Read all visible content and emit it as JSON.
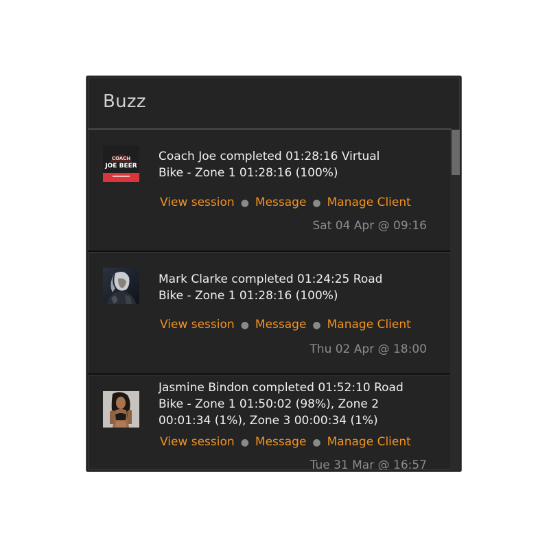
{
  "widget": {
    "title": "Buzz"
  },
  "feed": {
    "items": [
      {
        "summary": "Coach Joe completed 01:28:16 Virtual\nBike  -  Zone 1 01:28:16  (100%)",
        "actions": {
          "view_session": "View session",
          "message": "Message",
          "manage_client": "Manage Client"
        },
        "timestamp": "Sat 04 Apr @ 09:16",
        "avatar_text_top": "COACH",
        "avatar_text_main": "JOE BEER"
      },
      {
        "summary": "Mark Clarke completed 01:24:25 Road\nBike  -  Zone 1 01:28:16  (100%)",
        "actions": {
          "view_session": "View session",
          "message": "Message",
          "manage_client": "Manage Client"
        },
        "timestamp": "Thu 02 Apr @ 18:00"
      },
      {
        "summary": "Jasmine Bindon completed 01:52:10 Road\nBike  -  Zone 1 01:50:02  (98%), Zone 2\n00:01:34 (1%), Zone 3 00:00:34 (1%)",
        "actions": {
          "view_session": "View session",
          "message": "Message",
          "manage_client": "Manage Client"
        },
        "timestamp": "Tue 31 Mar @ 16:57"
      }
    ]
  },
  "colors": {
    "panel_bg": "#242424",
    "link": "#f3921f",
    "text": "#f0f0f0",
    "muted": "#8c8c8c"
  }
}
